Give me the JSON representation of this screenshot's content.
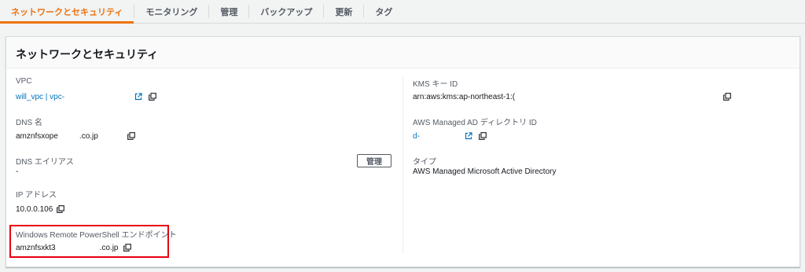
{
  "tabs": [
    {
      "label": "ネットワークとセキュリティ",
      "active": true
    },
    {
      "label": "モニタリング"
    },
    {
      "label": "管理"
    },
    {
      "label": "バックアップ"
    },
    {
      "label": "更新"
    },
    {
      "label": "タグ"
    }
  ],
  "panel": {
    "title": "ネットワークとセキュリティ",
    "left": {
      "vpc": {
        "label": "VPC",
        "value": "will_vpc | vpc-"
      },
      "dns_name": {
        "label": "DNS 名",
        "value_prefix": "amznfsxope",
        "value_suffix": ".co.jp"
      },
      "dns_alias": {
        "label": "DNS エイリアス",
        "value": "-",
        "manage_button": "管理"
      },
      "ip_address": {
        "label": "IP アドレス",
        "value": "10.0.0.106"
      },
      "powershell": {
        "label": "Windows Remote PowerShell エンドポイント",
        "value_prefix": "amznfsxkt3",
        "value_suffix": ".co.jp"
      }
    },
    "right": {
      "kms_key": {
        "label": "KMS キー ID",
        "value": "arn:aws:kms:ap-northeast-1:("
      },
      "managed_ad": {
        "label": "AWS Managed AD ディレクトリ ID",
        "value": "d-"
      },
      "type": {
        "label": "タイプ",
        "value": "AWS Managed Microsoft Active Directory"
      }
    }
  },
  "icons": {
    "external": "external-link-icon",
    "copy": "copy-icon"
  },
  "colors": {
    "accent": "#ec7211",
    "link": "#0073bb",
    "highlight": "#e60012"
  }
}
